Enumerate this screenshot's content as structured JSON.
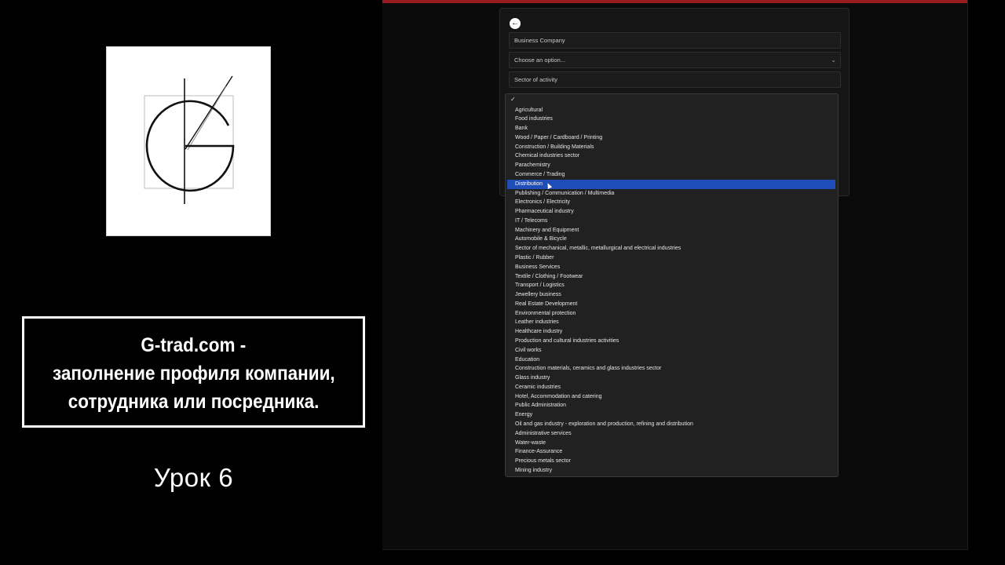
{
  "colors": {
    "accent_strip": "#9b1b22",
    "selection": "#1f4db8"
  },
  "video": {
    "title_lines": [
      "G-trad.com -",
      "заполнение профиля компании,",
      "сотрудника или посредника."
    ],
    "lesson": "Урок 6"
  },
  "form": {
    "back_icon": "arrow-left-icon",
    "company_type": "Business Company",
    "select_placeholder": "Choose an option...",
    "sector_placeholder": "Sector of activity"
  },
  "dropdown": {
    "checkmark": "✓",
    "selected_index": 8,
    "options": [
      "Agricultural",
      "Food industries",
      "Bank",
      "Wood / Paper / Cardboard / Printing",
      "Construction / Building Materials",
      "Chemical industries sector",
      "Parachemistry",
      "Commerce / Trading",
      "Distribution",
      "Publishing / Communication / Multimedia",
      "Electronics / Electricity",
      "Pharmaceutical industry",
      "IT / Telecoms",
      "Machinery and Equipment",
      "Automobile & Bicycle",
      "Sector of mechanical, metallic, metallurgical and electrical industries",
      "Plastic / Rubber",
      "Business Services",
      "Textile / Clothing / Footwear",
      "Transport / Logistics",
      "Jewellery business",
      "Real Estate Development",
      "Environmental protection",
      "Leather industries",
      "Healthcare industry",
      "Production and cultural industries activities",
      "Civil works",
      "Education",
      "Construction materials, ceramics and glass industries sector",
      "Glass industry",
      "Ceramic industries",
      "Hotel, Accommodation and catering",
      "Public Administration",
      "Energy",
      "Oil and gas industry - exploration and production, refining and distribution",
      "Administrative services",
      "Water-waste",
      "Finance-Assurance",
      "Precious metals sector",
      "Mining industry"
    ]
  }
}
